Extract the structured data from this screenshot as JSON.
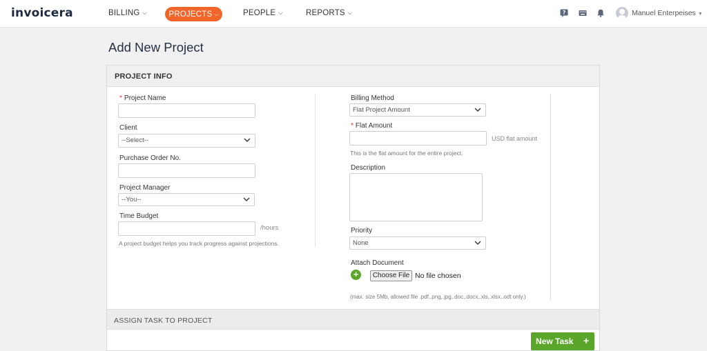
{
  "app": {
    "logo": "invoicera"
  },
  "nav": {
    "billing": "BILLING",
    "projects": "PROJECTS",
    "people": "PEOPLE",
    "reports": "REPORTS",
    "active": "PROJECTS"
  },
  "user": {
    "name": "Manuel Enterpeises"
  },
  "icons": [
    "help-icon",
    "keyboard-icon",
    "bell-icon",
    "avatar-icon"
  ],
  "page": {
    "title": "Add New Project"
  },
  "section": {
    "project_info": "PROJECT INFO",
    "assign_task": "ASSIGN TASK TO PROJECT"
  },
  "form": {
    "project_name": {
      "label": "Project Name",
      "required": "*",
      "value": ""
    },
    "client": {
      "label": "Client",
      "selected": "--Select--"
    },
    "po_number": {
      "label": "Purchase Order No.",
      "value": ""
    },
    "project_manager": {
      "label": "Project Manager",
      "selected": "--You--"
    },
    "time_budget": {
      "label": "Time Budget",
      "value": "",
      "unit": "/hours",
      "hint": "A project budget helps you track progress against projections."
    },
    "billing_method": {
      "label": "Billing Method",
      "selected": "Flat Project Amount"
    },
    "flat_amount": {
      "label": "Flat Amount",
      "required": "*",
      "value": "",
      "unit": "USD flat amount",
      "hint": "This is the flat amount for the entire project."
    },
    "description": {
      "label": "Description",
      "value": ""
    },
    "priority": {
      "label": "Priority",
      "selected": "None"
    },
    "attach": {
      "label": "Attach Document",
      "button": "Choose File",
      "status": "No file chosen",
      "hint": "(max. size 5Mb, allowed file .pdf,.png,.jpg,.doc,.docx,.xls,.xlsx,.odt only.)"
    }
  },
  "actions": {
    "new_task": "New Task",
    "new_task_icon": "+"
  },
  "colors": {
    "accent": "#f2652a",
    "success": "#5aa62a",
    "required": "#e0322b"
  }
}
